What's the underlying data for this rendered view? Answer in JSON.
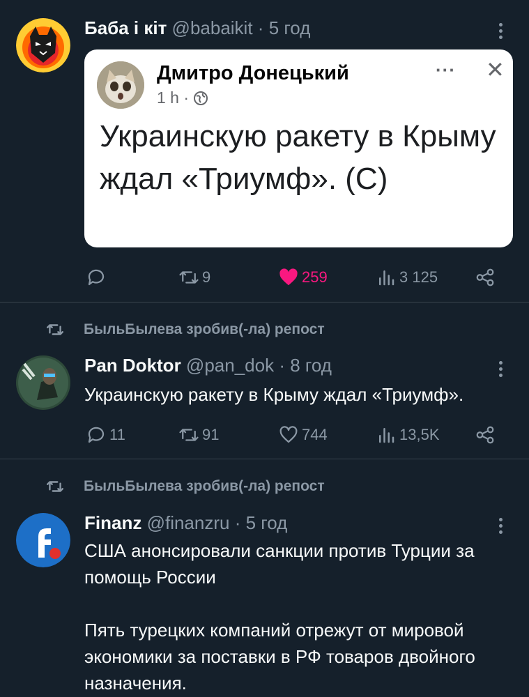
{
  "tweets": [
    {
      "name": "Баба і кіт",
      "handle": "@babaikit",
      "sep": "·",
      "time": "5 год",
      "card": {
        "author": "Дмитро Донецький",
        "time": "1 h ·",
        "dots": "···",
        "close": "✕",
        "text": "Украинскую ракету в Крыму ждал «Триумф». (С)"
      },
      "actions": {
        "replies": "",
        "reposts": "9",
        "likes": "259",
        "views": "3 125"
      },
      "colors": {
        "like_active": "#f91880"
      }
    },
    {
      "repost_label": "БыльБылева зробив(-ла) репост",
      "name": "Pan Doktor",
      "handle": "@pan_dok",
      "sep": "·",
      "time": "8 год",
      "text": "Украинскую ракету в Крыму ждал «Триумф».",
      "actions": {
        "replies": "11",
        "reposts": "91",
        "likes": "744",
        "views": "13,5K"
      }
    },
    {
      "repost_label": "БыльБылева зробив(-ла) репост",
      "name": "Finanz",
      "handle": "@finanzru",
      "sep": "·",
      "time": "5 год",
      "text_p1": "США анонсировали санкции против Турции за помощь России",
      "text_p2": "Пять турецких компаний отрежут от мировой экономики за поставки в РФ товаров двойного назначения."
    }
  ],
  "colors": {
    "background": "#15202b",
    "muted": "#8b98a5",
    "divider": "#38444d",
    "text": "#f7f9f9"
  }
}
